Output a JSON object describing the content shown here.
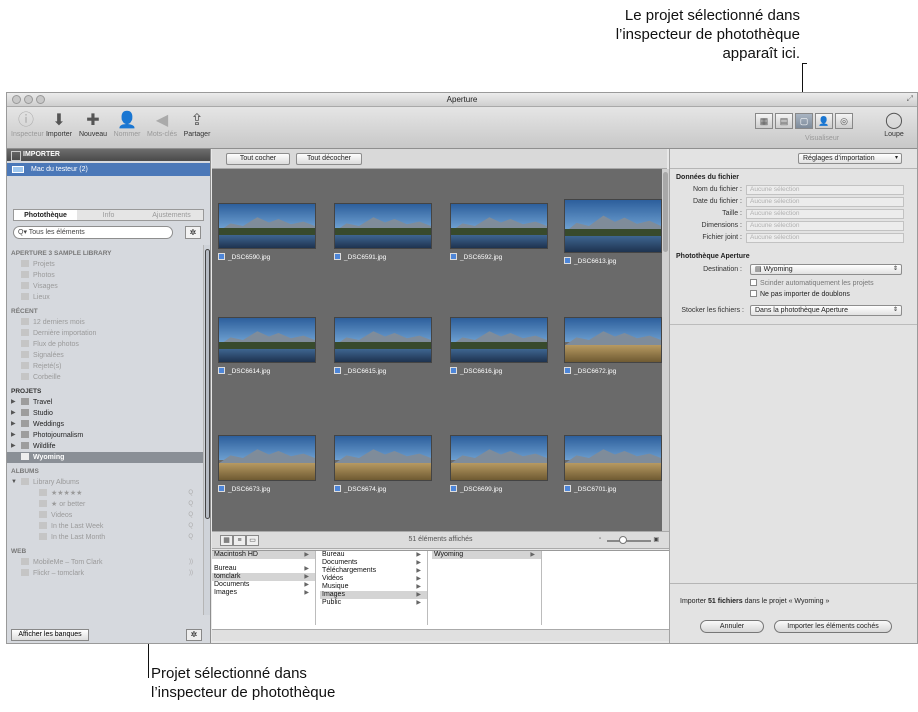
{
  "annotations": {
    "top": [
      "Le projet sélectionné dans",
      "l’inspecteur de photothèque",
      "apparaît ici."
    ],
    "bottom": [
      "Projet sélectionné dans",
      "l’inspecteur de photothèque"
    ]
  },
  "window": {
    "title": "Aperture"
  },
  "toolbar": {
    "items": [
      {
        "label": "Inspecteur",
        "icon": "info-icon"
      },
      {
        "label": "Importer",
        "icon": "import-arrow-icon"
      },
      {
        "label": "Nouveau",
        "icon": "plus-icon"
      },
      {
        "label": "Nommer",
        "icon": "person-icon"
      },
      {
        "label": "Mots-clés",
        "icon": "tag-icon"
      },
      {
        "label": "Partager",
        "icon": "share-icon"
      }
    ],
    "viewer_label": "Visualiseur",
    "loupe_label": "Loupe"
  },
  "sidebar": {
    "import_header": "IMPORTER",
    "device": "Mac du testeur (2)",
    "tabs": [
      "Photothèque",
      "Info",
      "Ajustements"
    ],
    "search_placeholder": "Tous les éléments",
    "library_title": "APERTURE 3 SAMPLE LIBRARY",
    "library_items": [
      "Projets",
      "Photos",
      "Visages",
      "Lieux"
    ],
    "recent_title": "RÉCENT",
    "recent_items": [
      "12 derniers mois",
      "Dernière importation",
      "Flux de photos",
      "Signalées",
      "Rejeté(s)",
      "Corbeille"
    ],
    "projects_title": "PROJETS",
    "projects": [
      "Travel",
      "Studio",
      "Weddings",
      "Photojournalism",
      "Wildlife",
      "Wyoming"
    ],
    "albums_title": "ALBUMS",
    "albums_group": "Library Albums",
    "albums": [
      "★★★★★",
      "★ or better",
      "Videos",
      "In the Last Week",
      "In the Last Month"
    ],
    "web_title": "WEB",
    "web_items": [
      "MobileMe – Tom Clark",
      "Flickr – tomclark"
    ],
    "show_banks_button": "Afficher les banques"
  },
  "browser": {
    "check_all": "Tout cocher",
    "uncheck_all": "Tout décocher",
    "photos": [
      "_DSC6590.jpg",
      "_DSC6591.jpg",
      "_DSC6592.jpg",
      "_DSC6613.jpg",
      "_DSC6614.jpg",
      "_DSC6615.jpg",
      "_DSC6616.jpg",
      "_DSC6672.jpg",
      "_DSC6673.jpg",
      "_DSC6674.jpg",
      "_DSC6699.jpg",
      "_DSC6701.jpg"
    ],
    "count": "51 éléments affichés",
    "columns": {
      "col1": [
        "Macintosh HD",
        "Bureau",
        "tomclark",
        "Documents",
        "Images"
      ],
      "col2": [
        "Bureau",
        "Documents",
        "Téléchargements",
        "Vidéos",
        "Musique",
        "Images",
        "Public"
      ],
      "col3": [
        "Wyoming"
      ]
    }
  },
  "inspector": {
    "import_settings": "Réglages d’importation",
    "file_data_title": "Données du fichier",
    "fields": [
      {
        "label": "Nom du fichier :",
        "value": "Aucune sélection"
      },
      {
        "label": "Date du fichier :",
        "value": "Aucune sélection"
      },
      {
        "label": "Taille :",
        "value": "Aucune sélection"
      },
      {
        "label": "Dimensions :",
        "value": "Aucune sélection"
      },
      {
        "label": "Fichier joint :",
        "value": "Aucune sélection"
      }
    ],
    "library_title": "Photothèque Aperture",
    "destination_label": "Destination :",
    "destination_value": "Wyoming",
    "split_label": "Scinder automatiquement les projets",
    "no_dup_label": "Ne pas importer de doublons",
    "store_label": "Stocker les fichiers :",
    "store_value": "Dans la photothèque Aperture",
    "import_prefix": "Importer",
    "import_count": "51 fichiers",
    "import_suffix": "dans le projet « Wyoming »",
    "cancel_button": "Annuler",
    "import_button": "Importer les éléments cochés"
  }
}
